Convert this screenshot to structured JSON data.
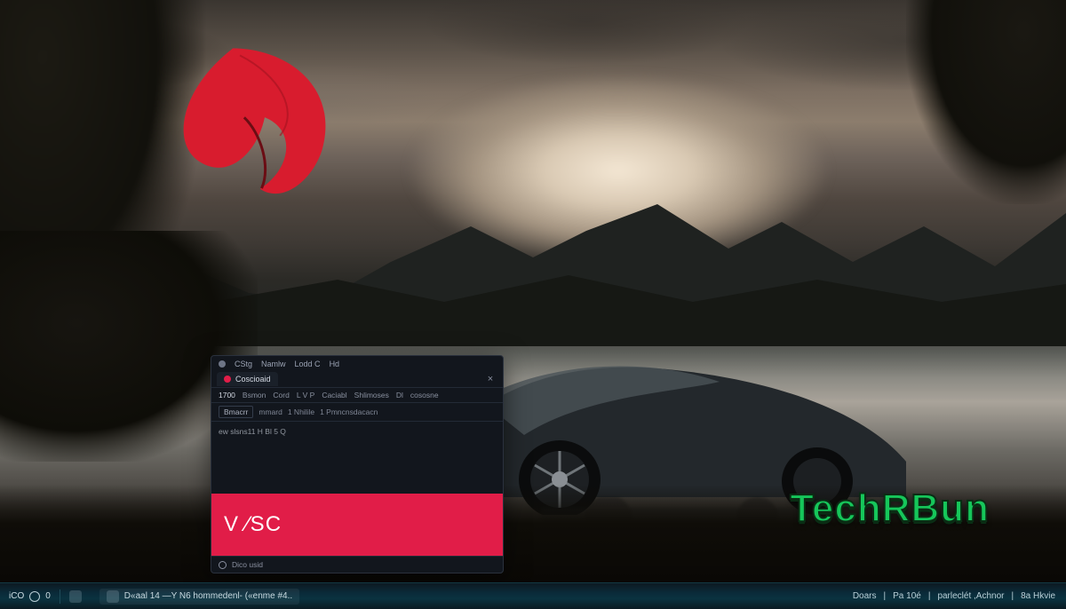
{
  "watermark": "TechRBun",
  "window": {
    "menu": {
      "item1": "CStg",
      "item2": "Namlw",
      "item3": "Lodd C",
      "item4": "Hd"
    },
    "tab": {
      "title": "Coscioaid",
      "close": "×"
    },
    "toolbar": {
      "name": "1700",
      "i1": "Bsmon",
      "i2": "Cord",
      "i3": "L V P",
      "i4": "Caciabl",
      "i5": "Shlimoses",
      "i6": "Dl",
      "i7": "cososne"
    },
    "subbar": {
      "box": "Bmacrr",
      "t1": "mmard",
      "t2": "1  Nhilile",
      "t3": "1  Pmncnsdacacn"
    },
    "body": {
      "line": "ew  slsns11 H  Bl  5  Q"
    },
    "brand": "V ⁄SC",
    "footer": {
      "label": "Dico usid"
    }
  },
  "taskbar": {
    "left_label": "iCO",
    "left_num": "0",
    "app_caption": "D«aal 14 —Y N6 hommedenl- («enme  #4..",
    "tray": {
      "t1": "Doars",
      "t2": "Pa 10é",
      "t3": "parleclét  ,Achnor",
      "t4": "8a Hkvie"
    }
  }
}
